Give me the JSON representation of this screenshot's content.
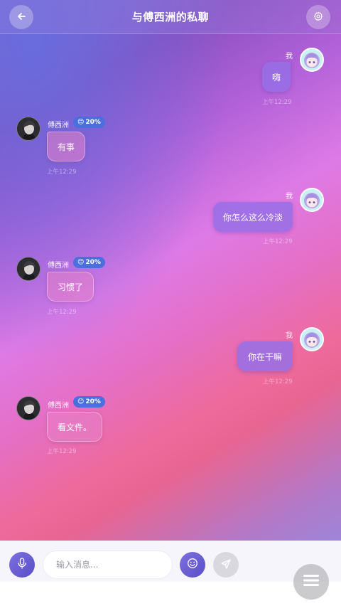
{
  "header": {
    "title": "与傅西洲的私聊",
    "back_icon": "arrow-left-icon",
    "settings_icon": "gear-icon"
  },
  "contact": {
    "name": "傅西洲",
    "badge_emoji": "😊",
    "badge_value": "20%"
  },
  "me": {
    "name": "我"
  },
  "messages": [
    {
      "sender": "me",
      "text": "嗨",
      "time": "上午12:29"
    },
    {
      "sender": "other",
      "text": "有事",
      "time": "上午12:29"
    },
    {
      "sender": "me",
      "text": "你怎么这么冷淡",
      "time": "上午12:29"
    },
    {
      "sender": "other",
      "text": "习惯了",
      "time": "上午12:29"
    },
    {
      "sender": "me",
      "text": "你在干嘛",
      "time": "上午12:29"
    },
    {
      "sender": "other",
      "text": "看文件。",
      "time": "上午12:29"
    }
  ],
  "composer": {
    "placeholder": "输入消息...",
    "mic_icon": "microphone-icon",
    "emoji_icon": "smiley-icon",
    "send_icon": "send-icon"
  },
  "fab_icon": "menu-icon",
  "colors": {
    "accent": "#6b5fd6",
    "badge": "#4b6fdc"
  }
}
